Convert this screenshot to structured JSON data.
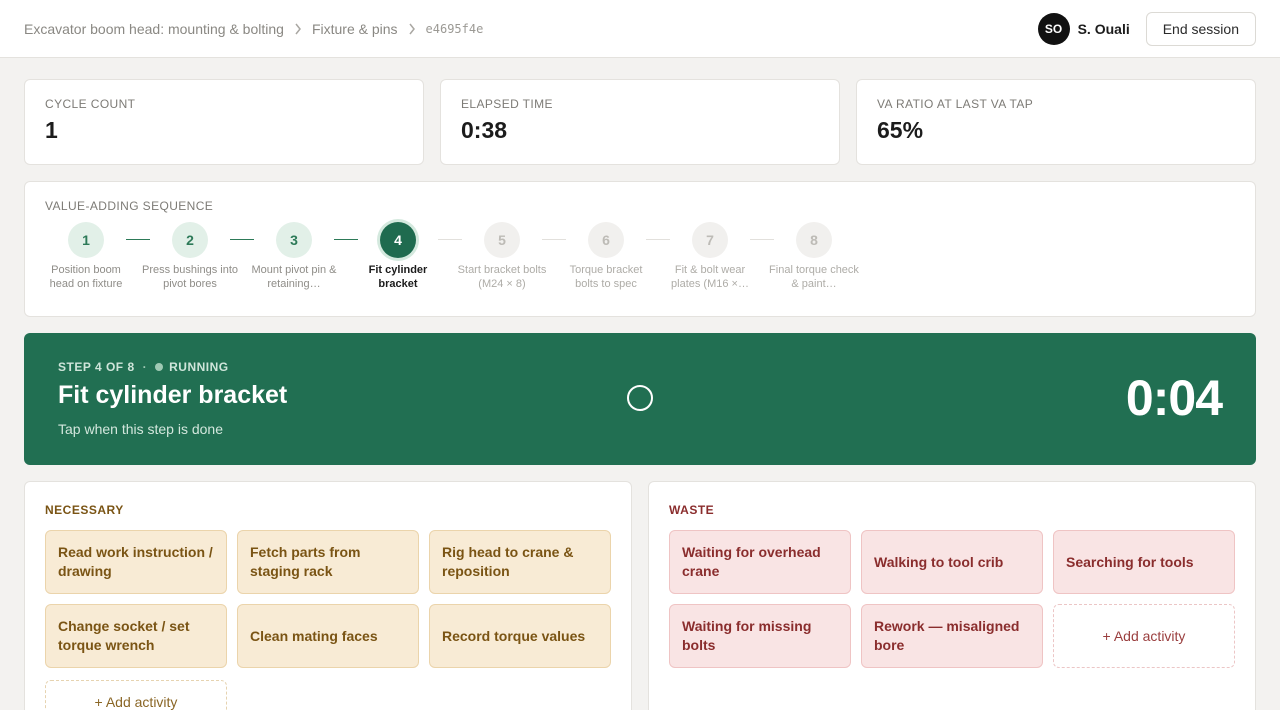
{
  "breadcrumb": {
    "items": [
      "Excavator boom head: mounting & bolting",
      "Fixture & pins"
    ],
    "session_id": "e4695f4e"
  },
  "user": {
    "initials": "SO",
    "name": "S. Ouali"
  },
  "header": {
    "end_session_label": "End session"
  },
  "stats": {
    "cycle_count": {
      "label": "Cycle count",
      "value": "1"
    },
    "elapsed_time": {
      "label": "Elapsed time",
      "value": "0:38"
    },
    "va_ratio": {
      "label": "VA ratio at last VA tap",
      "value": "65%"
    }
  },
  "sequence": {
    "title": "Value-adding sequence",
    "current_index": 4,
    "steps": [
      {
        "num": "1",
        "label": "Position boom head on fixture",
        "state": "done"
      },
      {
        "num": "2",
        "label": "Press bushings into pivot bores",
        "state": "done"
      },
      {
        "num": "3",
        "label": "Mount pivot pin & retaining…",
        "state": "done"
      },
      {
        "num": "4",
        "label": "Fit cylinder bracket",
        "state": "current"
      },
      {
        "num": "5",
        "label": "Start bracket bolts (M24 × 8)",
        "state": "todo"
      },
      {
        "num": "6",
        "label": "Torque bracket bolts to spec",
        "state": "todo"
      },
      {
        "num": "7",
        "label": "Fit & bolt wear plates (M16 ×…",
        "state": "todo"
      },
      {
        "num": "8",
        "label": "Final torque check & paint…",
        "state": "todo"
      }
    ]
  },
  "running": {
    "step_text": "STEP 4 OF 8",
    "status": "RUNNING",
    "title": "Fit cylinder bracket",
    "hint": "Tap when this step is done",
    "timer": "0:04"
  },
  "necessary": {
    "title": "Necessary",
    "color": "#7a5414",
    "activities": [
      "Read work instruction / drawing",
      "Fetch parts from staging rack",
      "Rig head to crane & reposition",
      "Change socket / set torque wrench",
      "Clean mating faces",
      "Record torque values"
    ],
    "add_label": "+ Add activity"
  },
  "waste": {
    "title": "Waste",
    "color": "#8a2d2d",
    "activities": [
      "Waiting for overhead crane",
      "Walking to tool crib",
      "Searching for tools",
      "Waiting for missing bolts",
      "Rework — misaligned bore"
    ],
    "add_label": "+ Add activity"
  }
}
